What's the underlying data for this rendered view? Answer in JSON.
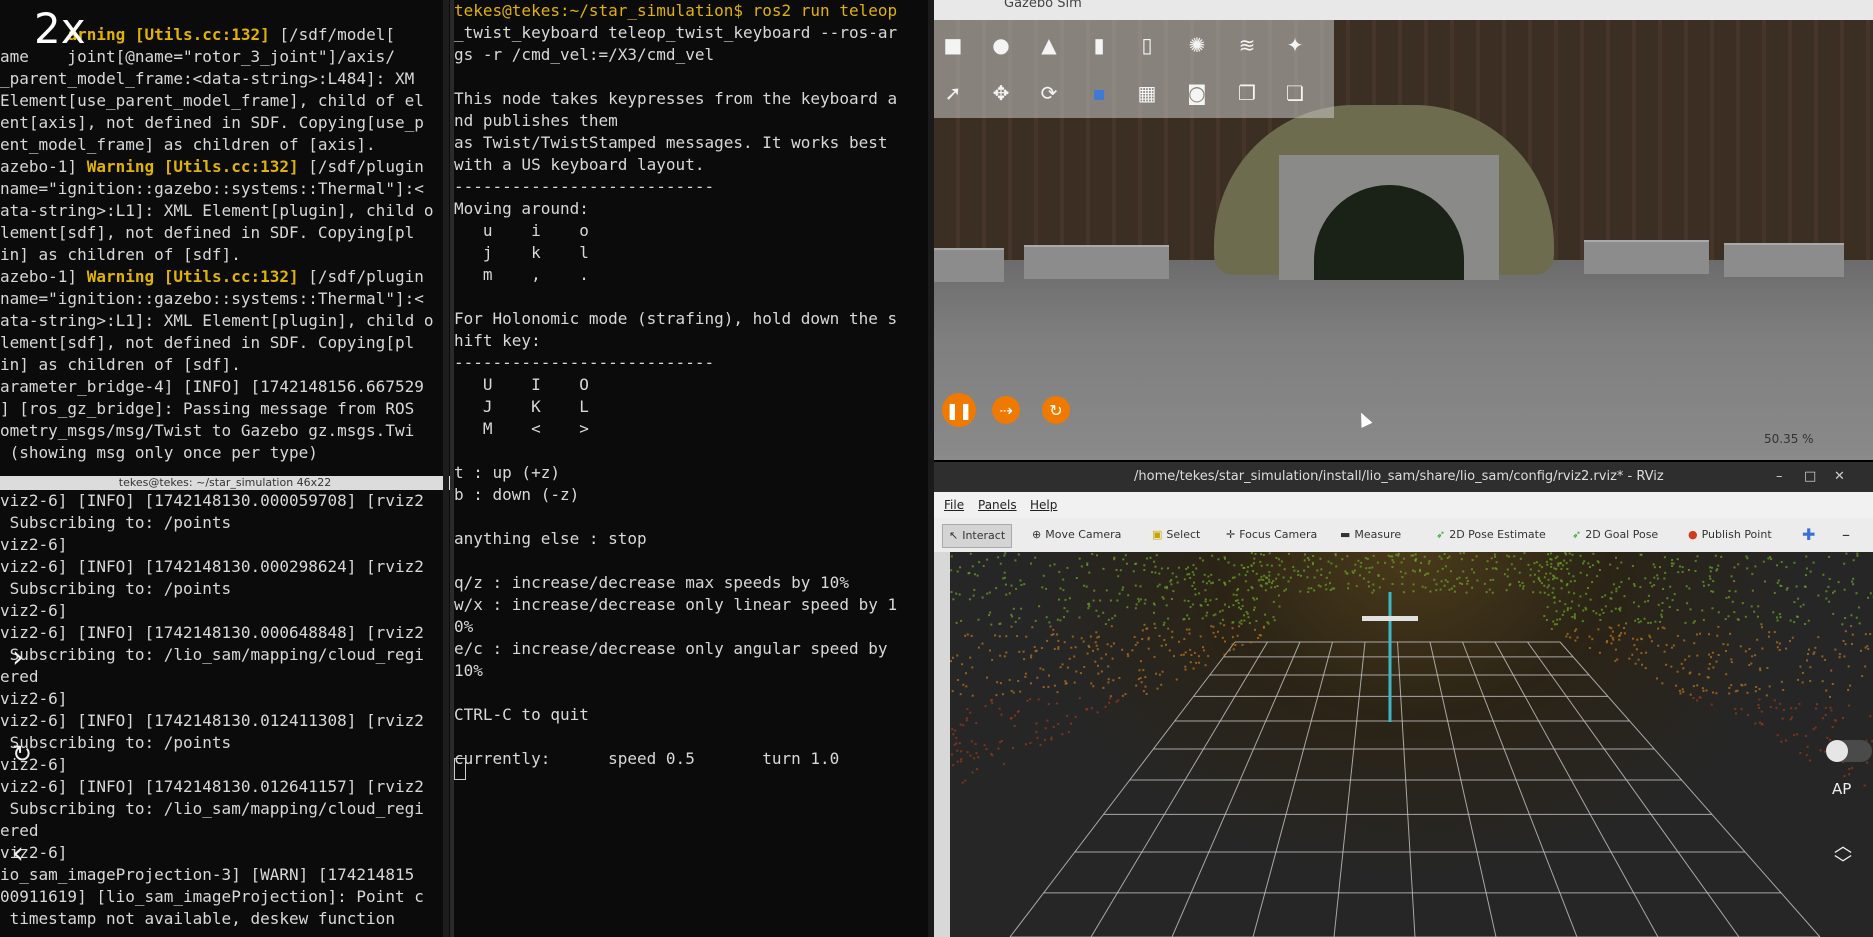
{
  "overlay": {
    "speed": "2x",
    "right_label": "AP"
  },
  "left_top_terminal": {
    "lines": [
      "",
      "       arning [Utils.cc:132] [/sdf/model[",
      "ame    joint[@name=\"rotor_3_joint\"]/axis/",
      "_parent_model_frame:<data-string>:L484]: XM",
      "Element[use_parent_model_frame], child of el",
      "ent[axis], not defined in SDF. Copying[use_p",
      "ent_model_frame] as children of [axis].",
      "azebo-1] Warning [Utils.cc:132] [/sdf/plugin",
      "name=\"ignition::gazebo::systems::Thermal\"]:<",
      "ata-string>:L1]: XML Element[plugin], child o",
      "lement[sdf], not defined in SDF. Copying[pl",
      "in] as children of [sdf].",
      "azebo-1] Warning [Utils.cc:132] [/sdf/plugin",
      "name=\"ignition::gazebo::systems::Thermal\"]:<",
      "ata-string>:L1]: XML Element[plugin], child o",
      "lement[sdf], not defined in SDF. Copying[pl",
      "in] as children of [sdf].",
      "arameter_bridge-4] [INFO] [1742148156.667529",
      "] [ros_gz_bridge]: Passing message from ROS",
      "ometry_msgs/msg/Twist to Gazebo gz.msgs.Twi",
      " (showing msg only once per type)"
    ]
  },
  "left_bottom_terminal": {
    "title": "tekes@tekes: ~/star_simulation 46x22",
    "lines": [
      " Subscribing to: /points",
      "viz2-6]",
      "viz2-6] [INFO] [1742148130.000298624] [rviz2",
      " Subscribing to: /points",
      "viz2-6]",
      "viz2-6] [INFO] [1742148130.000648848] [rviz2",
      " Subscribing to: /lio_sam/mapping/cloud_regi",
      "ered",
      "viz2-6]",
      "viz2-6] [INFO] [1742148130.012411308] [rviz2",
      " Subscribing to: /points",
      "viz2-6]",
      "viz2-6] [INFO] [1742148130.012641157] [rviz2",
      " Subscribing to: /lio_sam/mapping/cloud_regi",
      "ered",
      "viz2-6]",
      "io_sam_imageProjection-3] [WARN] [174214815",
      "00911619] [lio_sam_imageProjection]: Point c",
      " timestamp not available, deskew function"
    ],
    "first_line": "viz2-6] [INFO] [1742148130.000059708] [rviz2"
  },
  "mid_terminal": {
    "lines": [
      "tekes@tekes:~/star_simulation$ ros2 run teleop",
      "_twist_keyboard teleop_twist_keyboard --ros-ar",
      "gs -r /cmd_vel:=/X3/cmd_vel",
      "",
      "This node takes keypresses from the keyboard a",
      "nd publishes them",
      "as Twist/TwistStamped messages. It works best",
      "with a US keyboard layout.",
      "---------------------------",
      "Moving around:",
      "   u    i    o",
      "   j    k    l",
      "   m    ,    .",
      "",
      "For Holonomic mode (strafing), hold down the s",
      "hift key:",
      "---------------------------",
      "   U    I    O",
      "   J    K    L",
      "   M    <    >",
      "",
      "t : up (+z)",
      "b : down (-z)",
      "",
      "anything else : stop",
      "",
      "q/z : increase/decrease max speeds by 10%",
      "w/x : increase/decrease only linear speed by 1",
      "0%",
      "e/c : increase/decrease only angular speed by",
      "10%",
      "",
      "CTRL-C to quit",
      "",
      "currently:      speed 0.5       turn 1.0"
    ]
  },
  "gazebo": {
    "title": "Gazebo Sim",
    "rtf": "50.35 %"
  },
  "rviz": {
    "title": "/home/tekes/star_simulation/install/lio_sam/share/lio_sam/config/rviz2.rviz* - RViz",
    "menu": [
      "File",
      "Panels",
      "Help"
    ],
    "tools": [
      "Interact",
      "Move Camera",
      "Select",
      "Focus Camera",
      "Measure",
      "2D Pose Estimate",
      "2D Goal Pose",
      "Publish Point"
    ],
    "colors": {
      "accent": "#f07a00",
      "grid": "#c8c8c8",
      "axis": "#3fb6c6"
    }
  }
}
